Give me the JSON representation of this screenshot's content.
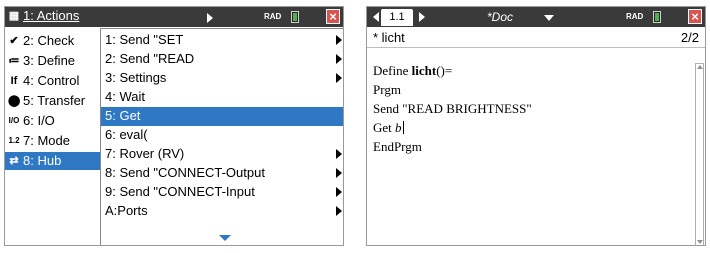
{
  "left": {
    "status": {
      "mode": "RAD"
    },
    "menu": {
      "top_item": {
        "icon": "actions-icon",
        "label": "1: Actions"
      },
      "items": [
        {
          "icon": "check-icon",
          "glyph": "✔",
          "label": "2: Check"
        },
        {
          "icon": "define-icon",
          "glyph": "≔",
          "label": "3: Define"
        },
        {
          "icon": "control-icon",
          "glyph": "If",
          "label": "4: Control"
        },
        {
          "icon": "transfer-icon",
          "glyph": "⬤",
          "label": "5: Transfer"
        },
        {
          "icon": "io-icon",
          "glyph": "I/O",
          "label": "6: I/O"
        },
        {
          "icon": "mode-icon",
          "glyph": "1.2",
          "label": "7: Mode"
        },
        {
          "icon": "hub-icon",
          "glyph": "⇄",
          "label": "8: Hub"
        }
      ],
      "selected_index": 6
    },
    "submenu": {
      "items": [
        {
          "label": "1: Send \"SET",
          "has_arrow": true
        },
        {
          "label": "2: Send \"READ",
          "has_arrow": true
        },
        {
          "label": "3: Settings",
          "has_arrow": true
        },
        {
          "label": "4: Wait",
          "has_arrow": false
        },
        {
          "label": "5: Get",
          "has_arrow": false
        },
        {
          "label": "6: eval(",
          "has_arrow": false
        },
        {
          "label": "7: Rover (RV)",
          "has_arrow": true
        },
        {
          "label": "8: Send \"CONNECT-Output",
          "has_arrow": true
        },
        {
          "label": "9: Send \"CONNECT-Input",
          "has_arrow": true
        },
        {
          "label": "A:Ports",
          "has_arrow": true
        }
      ],
      "selected_index": 4
    }
  },
  "right": {
    "status": {
      "tab": "1.1",
      "doc_title": "*Doc",
      "mode": "RAD"
    },
    "editor": {
      "program_name": "* licht",
      "line_counter": "2/2",
      "lines": {
        "define_prefix": "Define ",
        "define_name": "licht",
        "define_suffix": "()=",
        "prgm": "Prgm",
        "send": "Send \"READ BRIGHTNESS\"",
        "get_prefix": "Get ",
        "get_var": "b",
        "endprgm": "EndPrgm"
      }
    }
  },
  "colors": {
    "topbar": "#3a3a3a",
    "selection": "#2f78c4",
    "close": "#d9534f",
    "battery": "#4caf50"
  }
}
